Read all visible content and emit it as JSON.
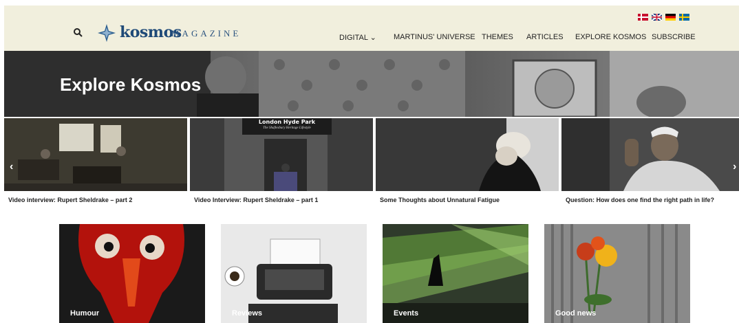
{
  "brand": {
    "name": "kosmos",
    "subtitle": "MAGAZINE"
  },
  "nav": [
    {
      "label": "DIGITAL ⌄"
    },
    {
      "label": "MARTINUS' UNIVERSE"
    },
    {
      "label": "THEMES"
    },
    {
      "label": "ARTICLES"
    },
    {
      "label": "EXPLORE KOSMOS"
    },
    {
      "label": "SUBSCRIBE"
    }
  ],
  "hero": {
    "title": "Explore Kosmos"
  },
  "slides": [
    {
      "caption": "Video interview: Rupert Sheldrake – part 2",
      "sign": ""
    },
    {
      "caption": "Video Interview: Rupert Sheldrake – part 1",
      "sign": "London Hyde Park"
    },
    {
      "caption": "Some Thoughts about Unnatural Fatigue",
      "sign": ""
    },
    {
      "caption": "Question: How does one find the right path in life?",
      "sign": ""
    }
  ],
  "sign_sub": "The Shaftesbury Heritage Lifestyle",
  "tiles": [
    {
      "label": "Humour"
    },
    {
      "label": "Reviews"
    },
    {
      "label": "Events"
    },
    {
      "label": "Good news"
    }
  ],
  "colors": {
    "header_bg": "#f1efdd",
    "brand": "#1f4a78"
  }
}
